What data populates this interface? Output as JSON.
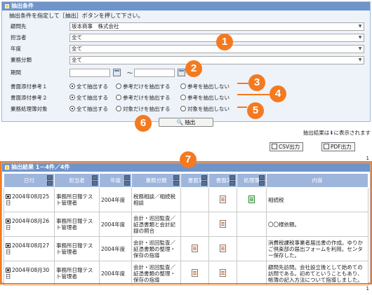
{
  "condition_panel": {
    "title": "抽出条件",
    "instruction": "抽出条件を指定して［抽出］ボタンを押して下さい。",
    "fields": [
      {
        "label": "顧問先",
        "value": "坂本商事　株式会社"
      },
      {
        "label": "担当者",
        "value": "全て"
      },
      {
        "label": "年度",
        "value": "全て"
      },
      {
        "label": "業務分類",
        "value": "全て"
      }
    ],
    "period": {
      "label": "期間",
      "separator": "〜"
    },
    "radio_rows": [
      {
        "label": "書面添付参考１",
        "options": [
          "全て抽出する",
          "参考だけを抽出する",
          "参考を抽出しない"
        ]
      },
      {
        "label": "書面添付参考２",
        "options": [
          "全て抽出する",
          "参考だけを抽出する",
          "参考を抽出しない"
        ]
      },
      {
        "label": "業務処理簿対象",
        "options": [
          "全て抽出する",
          "対象だけを抽出する",
          "対象を抽出しない"
        ]
      }
    ],
    "search_button": "抽出"
  },
  "result_note": {
    "prefix": "抽出結果は",
    "suffix": "に表示されます"
  },
  "export": {
    "csv": "CSV出力",
    "pdf": "PDF出力"
  },
  "page_number": "1",
  "results": {
    "title": "抽出結果 1－4件／4件",
    "columns": [
      "日付",
      "担当者",
      "年度",
      "業務分類",
      "書面1",
      "書面2",
      "処理簿",
      "内容"
    ],
    "rows": [
      {
        "date": "2004年08月25日",
        "staff": "事務所日報テスト管理者",
        "year": "2004年度",
        "category": "税務相談／相続税相談",
        "doc1": false,
        "doc2": true,
        "ledger": true,
        "content": "相続税"
      },
      {
        "date": "2004年08月26日",
        "staff": "事務所日報テスト管理者",
        "year": "2004年度",
        "category": "会計・巡回監査／証憑書類と会計記録の照合",
        "doc1": false,
        "doc2": true,
        "ledger": false,
        "content": "〇〇様依頼。"
      },
      {
        "date": "2004年08月27日",
        "staff": "事務所日報テスト管理者",
        "year": "2004年度",
        "category": "会計・巡回監査／証憑書類の整理・保存の指導",
        "doc1": true,
        "doc2": true,
        "ledger": false,
        "content": "消費税課税事業者届出書の作成。ゆりかご倶楽部の届出フォームを利用。センター保存した。"
      },
      {
        "date": "2004年08月30日",
        "staff": "事務所日報テスト管理者",
        "year": "2004年度",
        "category": "会計・巡回監査／証憑書類の整理・保存の指導",
        "doc1": true,
        "doc2": true,
        "ledger": false,
        "content": "顧問先訪問。会社設立後として始めての訪問である。初めてということもあり、帳簿の記入方法について指導しました。"
      }
    ]
  },
  "callouts": [
    "1",
    "2",
    "3",
    "4",
    "5",
    "6",
    "7"
  ],
  "colors": {
    "accent": "#f47a20",
    "header": "#6f94c9"
  }
}
